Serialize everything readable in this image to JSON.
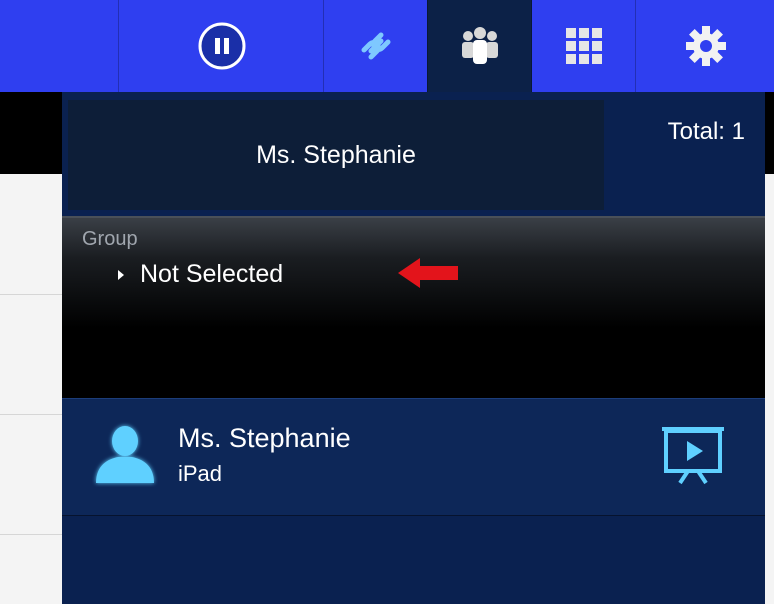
{
  "toolbar": {
    "icons": [
      "pause-icon",
      "link-icon",
      "group-icon",
      "grid-icon",
      "gear-icon"
    ],
    "active": "group-icon"
  },
  "teacher": {
    "name": "Ms. Stephanie",
    "total": "Total: 1"
  },
  "group": {
    "label": "Group",
    "value": "Not Selected"
  },
  "student": {
    "name": "Ms. Stephanie",
    "device": "iPad",
    "action_icon": "presentation-icon"
  },
  "colors": {
    "toolbar": "#2f3ff0",
    "panel": "#0a2150",
    "accent": "#5fd0ff",
    "annotation": "#e3141b"
  }
}
